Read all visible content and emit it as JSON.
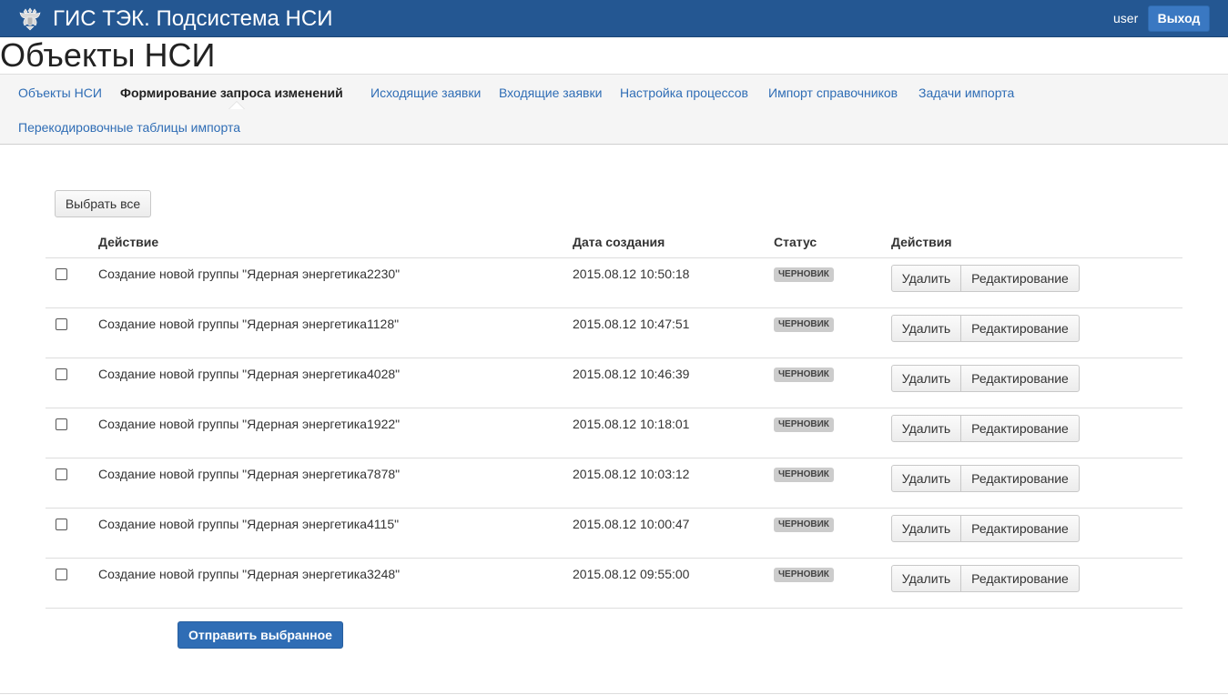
{
  "header": {
    "app_title": "ГИС ТЭК. Подсистема НСИ",
    "username": "user",
    "logout_label": "Выход",
    "accent_color": "#245792"
  },
  "page_title": "Объекты НСИ",
  "nav": {
    "items": [
      {
        "label": "Объекты НСИ",
        "active": false
      },
      {
        "label": "Формирование запроса изменений",
        "active": true
      },
      {
        "label": "Исходящие заявки",
        "active": false
      },
      {
        "label": "Входящие заявки",
        "active": false
      },
      {
        "label": "Настройка процессов",
        "active": false
      },
      {
        "label": "Импорт справочников",
        "active": false
      },
      {
        "label": "Задачи импорта",
        "active": false
      },
      {
        "label": "Перекодировочные таблицы импорта",
        "active": false
      }
    ]
  },
  "select_all_label": "Выбрать все",
  "table": {
    "headers": {
      "action": "Действие",
      "date": "Дата создания",
      "status": "Статус",
      "actions": "Действия"
    },
    "rows": [
      {
        "action": "Создание новой группы \"Ядерная энергетика2230\"",
        "date": "2015.08.12 10:50:18",
        "status": "ЧЕРНОВИК",
        "checked": false,
        "delete_label": "Удалить",
        "edit_label": "Редактирование"
      },
      {
        "action": "Создание новой группы \"Ядерная энергетика1128\"",
        "date": "2015.08.12 10:47:51",
        "status": "ЧЕРНОВИК",
        "checked": false,
        "delete_label": "Удалить",
        "edit_label": "Редактирование"
      },
      {
        "action": "Создание новой группы \"Ядерная энергетика4028\"",
        "date": "2015.08.12 10:46:39",
        "status": "ЧЕРНОВИК",
        "checked": false,
        "delete_label": "Удалить",
        "edit_label": "Редактирование"
      },
      {
        "action": "Создание новой группы \"Ядерная энергетика1922\"",
        "date": "2015.08.12 10:18:01",
        "status": "ЧЕРНОВИК",
        "checked": false,
        "delete_label": "Удалить",
        "edit_label": "Редактирование"
      },
      {
        "action": "Создание новой группы \"Ядерная энергетика7878\"",
        "date": "2015.08.12 10:03:12",
        "status": "ЧЕРНОВИК",
        "checked": false,
        "delete_label": "Удалить",
        "edit_label": "Редактирование"
      },
      {
        "action": "Создание новой группы \"Ядерная энергетика4115\"",
        "date": "2015.08.12 10:00:47",
        "status": "ЧЕРНОВИК",
        "checked": false,
        "delete_label": "Удалить",
        "edit_label": "Редактирование"
      },
      {
        "action": "Создание новой группы \"Ядерная энергетика3248\"",
        "date": "2015.08.12 09:55:00",
        "status": "ЧЕРНОВИК",
        "checked": false,
        "delete_label": "Удалить",
        "edit_label": "Редактирование"
      }
    ]
  },
  "send_selected_label": "Отправить выбранное",
  "icons": {
    "emblem": "coat-of-arms-icon",
    "checkbox": "checkbox-icon"
  }
}
